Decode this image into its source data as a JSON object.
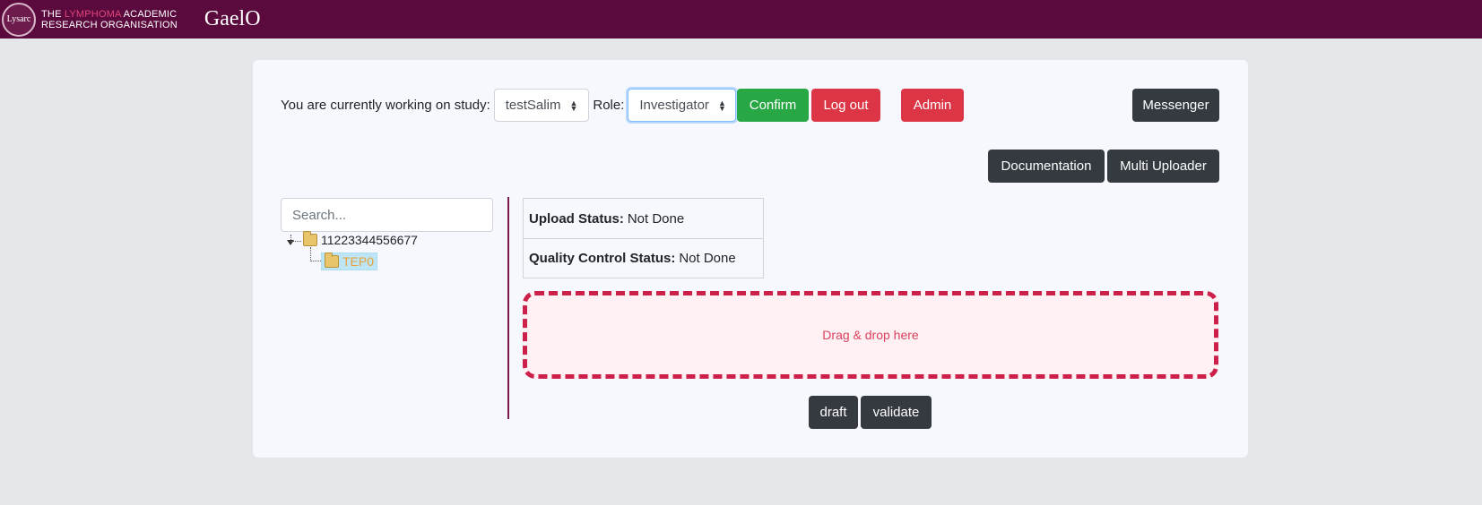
{
  "header": {
    "logo_circle": "Lysarc",
    "logo_line1_pre": "THE ",
    "logo_line1_accent": "LYMPHOMA",
    "logo_line1_post": " ACADEMIC",
    "logo_line2": "RESEARCH ORGANISATION",
    "app_name": "GaelO"
  },
  "study": {
    "label": "You are currently working on study:",
    "selected": "testSalim",
    "role_label": "Role:",
    "role_selected": "Investigator"
  },
  "buttons": {
    "confirm": "Confirm",
    "logout": "Log out",
    "admin": "Admin",
    "messenger": "Messenger",
    "documentation": "Documentation",
    "multi_uploader": "Multi Uploader",
    "draft": "draft",
    "validate": "validate"
  },
  "search": {
    "placeholder": "Search..."
  },
  "tree": {
    "patient": "11223344556677",
    "visit": "TEP0"
  },
  "status": {
    "upload_label": "Upload Status:",
    "upload_value": "Not Done",
    "qc_label": "Quality Control Status:",
    "qc_value": "Not Done"
  },
  "dropzone": {
    "text": "Drag & drop here"
  },
  "colors": {
    "header_bg": "#5a0a3d",
    "accent": "#e2457d",
    "success": "#28a745",
    "danger": "#dc3545",
    "dark": "#343a40"
  }
}
